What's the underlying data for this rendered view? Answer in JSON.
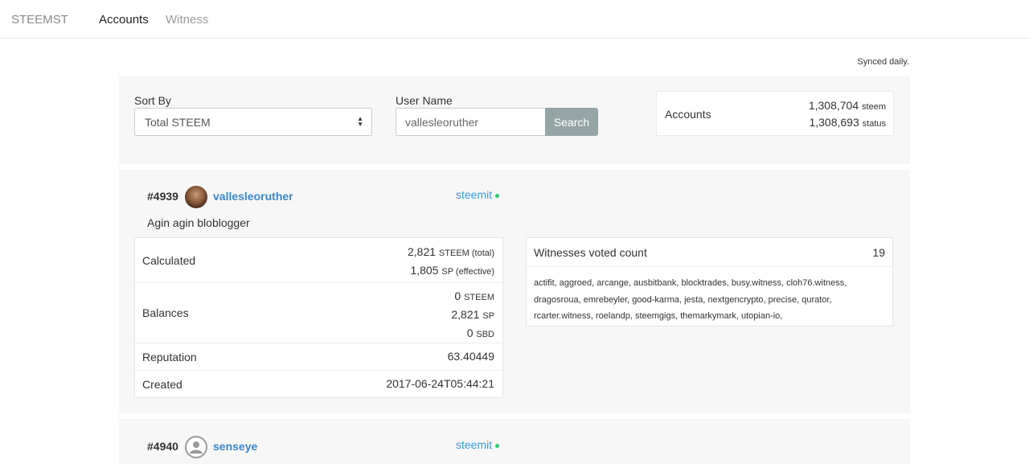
{
  "nav": {
    "brand": "STEEMST",
    "links": [
      {
        "label": "Accounts",
        "active": true
      },
      {
        "label": "Witness",
        "active": false
      }
    ]
  },
  "synced_note": "Synced daily.",
  "search": {
    "sort_label": "Sort By",
    "sort_value": "Total STEEM",
    "username_label": "User Name",
    "username_value": "vallesleoruther",
    "search_button": "Search"
  },
  "stats": {
    "label": "Accounts",
    "steem_count": "1,308,704",
    "steem_unit": "steem",
    "status_count": "1,308,693",
    "status_unit": "status"
  },
  "accounts": [
    {
      "rank": "#4939",
      "username": "vallesleoruther",
      "source": "steemit",
      "about": "Agin agin bloblogger",
      "calculated_label": "Calculated",
      "calculated_total": "2,821",
      "calculated_total_unit": "STEEM (total)",
      "calculated_effective": "1,805",
      "calculated_effective_unit": "SP (effective)",
      "balances_label": "Balances",
      "balance_steem": "0",
      "balance_steem_unit": "STEEM",
      "balance_sp": "2,821",
      "balance_sp_unit": "SP",
      "balance_sbd": "0",
      "balance_sbd_unit": "SBD",
      "reputation_label": "Reputation",
      "reputation": "63.40449",
      "created_label": "Created",
      "created": "2017-06-24T05:44:21",
      "witnesses_title": "Witnesses voted count",
      "witnesses_count": "19",
      "witnesses_list": "actifit, aggroed, arcange, ausbitbank, blocktrades, busy.witness, cloh76.witness, dragosroua, emrebeyler, good-karma, jesta, nextgencrypto, precise, qurator, rcarter.witness, roelandp, steemgigs, themarkymark, utopian-io,"
    },
    {
      "rank": "#4940",
      "username": "senseye",
      "source": "steemit"
    }
  ],
  "colors": {
    "link": "#3a87c8",
    "online_dot": "#2ecc71",
    "button": "#95a5a6",
    "panel_bg": "#f7f7f7"
  }
}
